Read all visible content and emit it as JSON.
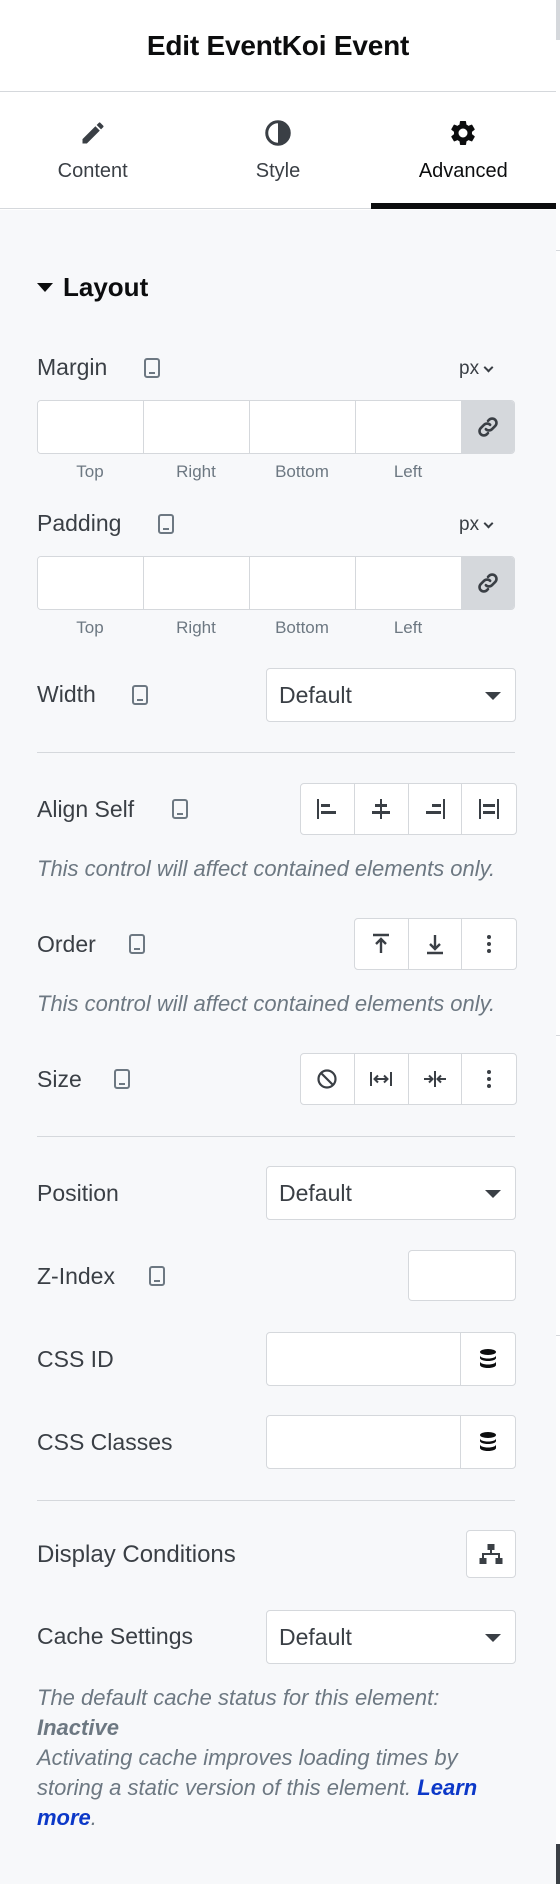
{
  "header": {
    "title": "Edit EventKoi Event"
  },
  "tabs": [
    {
      "label": "Content",
      "icon": "pencil-icon"
    },
    {
      "label": "Style",
      "icon": "half-circle-icon"
    },
    {
      "label": "Advanced",
      "icon": "gear-icon",
      "active": true
    }
  ],
  "layout": {
    "section_title": "Layout",
    "margin": {
      "label": "Margin",
      "unit": "px",
      "sides": [
        "Top",
        "Right",
        "Bottom",
        "Left"
      ]
    },
    "padding": {
      "label": "Padding",
      "unit": "px",
      "sides": [
        "Top",
        "Right",
        "Bottom",
        "Left"
      ]
    },
    "width": {
      "label": "Width",
      "value": "Default"
    },
    "align_self": {
      "label": "Align Self",
      "note": "This control will affect contained elements only."
    },
    "order": {
      "label": "Order",
      "note": "This control will affect contained elements only."
    },
    "size": {
      "label": "Size"
    },
    "position": {
      "label": "Position",
      "value": "Default"
    },
    "z_index": {
      "label": "Z-Index"
    },
    "css_id": {
      "label": "CSS ID"
    },
    "css_classes": {
      "label": "CSS Classes"
    },
    "display_conditions": {
      "label": "Display Conditions"
    },
    "cache": {
      "label": "Cache Settings",
      "value": "Default",
      "note_line1": "The default cache status for this element:",
      "note_status": "Inactive",
      "note_line2": "Activating cache improves loading times by storing a static version of this element.",
      "learn_more": "Learn more"
    }
  },
  "colors": {
    "text": "#3a3f45",
    "heading": "#0c0d0e",
    "border": "#d5d8dc",
    "link": "#0c38c8",
    "background": "#f7f8fa"
  }
}
